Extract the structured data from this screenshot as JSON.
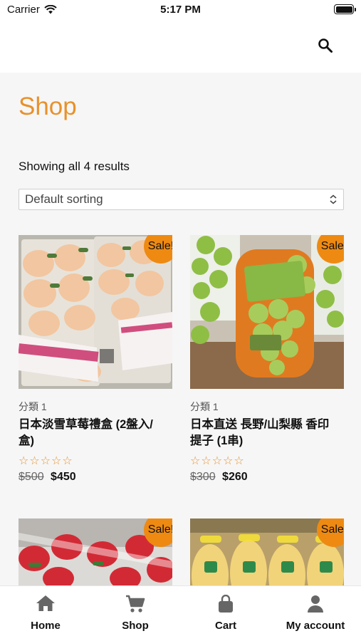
{
  "status_bar": {
    "carrier": "Carrier",
    "time": "5:17 PM"
  },
  "header": {
    "search_icon": "search-icon"
  },
  "main": {
    "title": "Shop",
    "result_count": "Showing all 4 results",
    "sort": {
      "selected": "Default sorting"
    },
    "products": [
      {
        "category": "分類 1",
        "name": "日本淡雪草莓禮盒 (2盤入/盒)",
        "old_price": "$500",
        "price": "$450",
        "badge": "Sale!",
        "rating": "☆☆☆☆☆"
      },
      {
        "category": "分類 1",
        "name": "日本直送 長野/山梨縣 香印提子 (1串)",
        "old_price": "$300",
        "price": "$260",
        "badge": "Sale!",
        "rating": "☆☆☆☆☆"
      },
      {
        "badge": "Sale!"
      },
      {
        "badge": "Sale!"
      }
    ]
  },
  "tab_bar": {
    "tabs": [
      {
        "label": "Home",
        "icon": "home-icon"
      },
      {
        "label": "Shop",
        "icon": "cart-icon"
      },
      {
        "label": "Cart",
        "icon": "bag-icon"
      },
      {
        "label": "My account",
        "icon": "user-icon"
      }
    ]
  },
  "colors": {
    "accent": "#e8912b",
    "badge": "#ee8a12",
    "tab_icon": "#666666"
  }
}
